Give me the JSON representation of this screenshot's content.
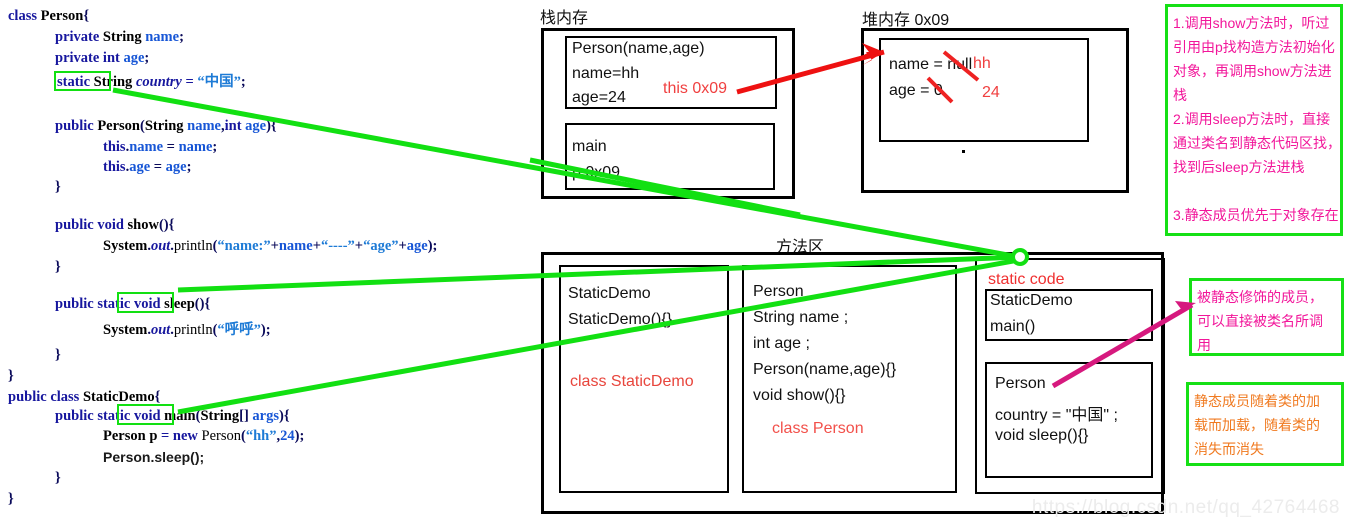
{
  "code_panel": {
    "lines": [
      "class Person{",
      "private String name;",
      "private int age;",
      "static String country = “中国”;",
      "public Person(String name,int age){",
      "this.name = name;",
      "this.age = age;",
      "}",
      "public void show(){",
      "System.out.println(“name:”+name+“----”+“age”+age);",
      "}",
      "public static void sleep(){",
      "System.out.println(“呼呼”);",
      "}",
      "}",
      "public class StaticDemo{",
      "public static void main(String[] args){",
      "Person p = new Person(“hh”,24);",
      "Person.sleep();",
      "}",
      "}"
    ],
    "highlight_keyword": "static",
    "highlight_color": "#12e012"
  },
  "stack": {
    "title": "栈内存",
    "frames": [
      {
        "lines": [
          "Person(name,age)",
          "name=hh",
          "age=24"
        ]
      },
      {
        "lines": [
          "main",
          "p 0x09"
        ]
      }
    ],
    "annotation": "this 0x09",
    "annotation_color": "#f04040"
  },
  "heap": {
    "title": "堆内存  0x09",
    "object_fields": [
      "name = null",
      "age = 0"
    ],
    "overwritten_values": [
      "hh",
      "24"
    ],
    "strike_color": "#ee2222"
  },
  "method_area": {
    "title": "方法区",
    "class_blocks": [
      {
        "lines": [
          "StaticDemo",
          "StaticDemo(){}"
        ],
        "label": "class StaticDemo",
        "label_color": "#e8453c"
      },
      {
        "lines": [
          "Person",
          "String name ;",
          "int age ;",
          "Person(name,age){}",
          "void show(){}"
        ],
        "label": "class Person",
        "label_color": "#f2504a"
      }
    ],
    "static_area": {
      "title": "static code",
      "title_color": "#f03030",
      "blocks": [
        {
          "lines": [
            "StaticDemo",
            "main()"
          ]
        },
        {
          "lines": [
            "Person",
            "country = \"中国\" ;",
            "void sleep(){}"
          ]
        }
      ]
    }
  },
  "notes": {
    "top_right": {
      "color": "#f2169a",
      "border_color": "#16e016",
      "lines": [
        "1.调用show方法时，听过",
        "引用由p找构造方法初始化",
        "对象，再调用show方法进",
        "栈",
        "2.调用sleep方法时，直接",
        "通过类名到静态代码区找，",
        "找到后sleep方法进栈",
        "",
        "3.静态成员优先于对象存在"
      ]
    },
    "middle_right": {
      "color": "#f2169a",
      "border_color": "#16e016",
      "lines": [
        "被静态修饰的成员，",
        "可以直接被类名所调",
        "用"
      ]
    },
    "bottom_right": {
      "color": "#f07a20",
      "border_color": "#16e016",
      "lines": [
        "静态成员随着类的加",
        "载而加载，随着类的",
        "消失而消失"
      ]
    }
  },
  "watermark": "https://blog.csdn.net/qq_42764468",
  "colors": {
    "green_line": "#12e012",
    "red_arrow": "#ee1111",
    "magenta_arrow": "#d6197e",
    "keyword": "#17179e",
    "string": "#1e7bd6"
  }
}
